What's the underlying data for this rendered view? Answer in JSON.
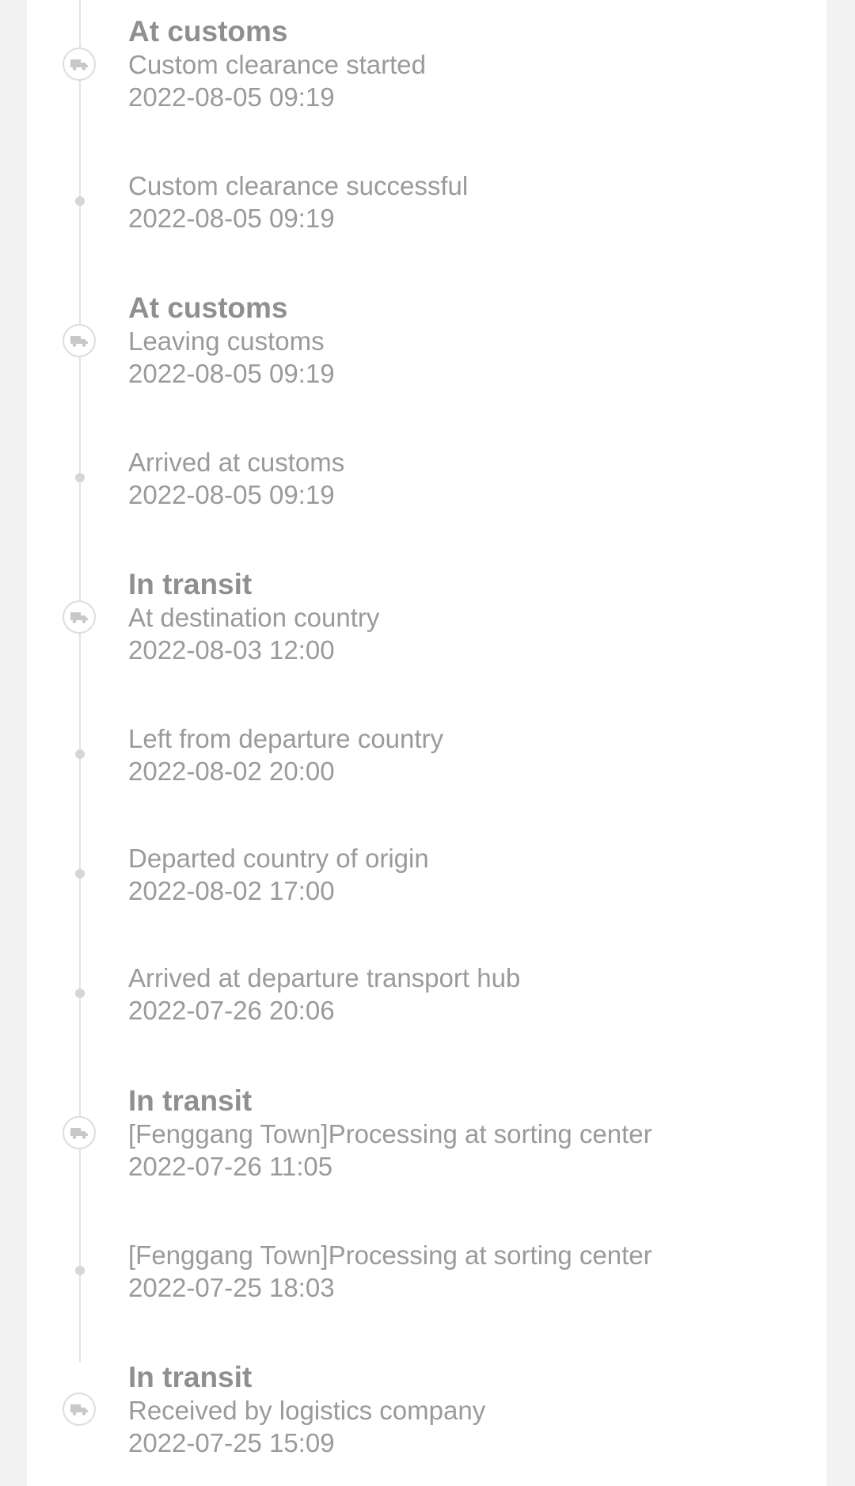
{
  "icons": {
    "major": "truck-icon",
    "minor": "dot"
  },
  "colors": {
    "background": "#f2f2f2",
    "card": "#ffffff",
    "text": "#9a9a9a",
    "timeline": "#e4e4e4"
  },
  "events": [
    {
      "status": "At customs",
      "description": "Custom clearance started",
      "time": "2022-08-05 09:19"
    },
    {
      "status": "",
      "description": "Custom clearance successful",
      "time": "2022-08-05 09:19"
    },
    {
      "status": "At customs",
      "description": "Leaving customs",
      "time": "2022-08-05 09:19"
    },
    {
      "status": "",
      "description": "Arrived at customs",
      "time": "2022-08-05 09:19"
    },
    {
      "status": "In transit",
      "description": "At destination country",
      "time": "2022-08-03 12:00"
    },
    {
      "status": "",
      "description": "Left from departure country",
      "time": "2022-08-02 20:00"
    },
    {
      "status": "",
      "description": "Departed country of origin",
      "time": "2022-08-02 17:00"
    },
    {
      "status": "",
      "description": "Arrived at departure transport hub",
      "time": "2022-07-26 20:06"
    },
    {
      "status": "In transit",
      "description": "[Fenggang Town]Processing at sorting center",
      "time": "2022-07-26 11:05"
    },
    {
      "status": "",
      "description": "[Fenggang Town]Processing at sorting center",
      "time": "2022-07-25 18:03"
    },
    {
      "status": "In transit",
      "description": "Received by logistics company",
      "time": "2022-07-25 15:09"
    }
  ]
}
